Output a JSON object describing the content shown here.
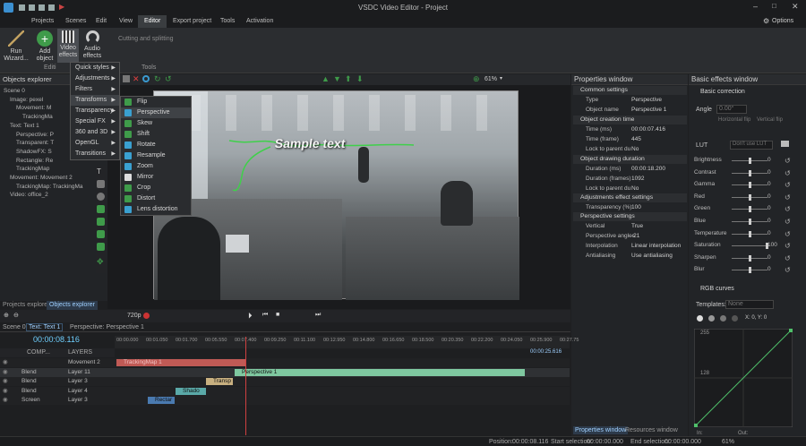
{
  "app": {
    "title": "VSDC Video Editor - Project",
    "options_label": "Options"
  },
  "menu_tabs": [
    "Projects",
    "Scenes",
    "Edit",
    "View",
    "Editor",
    "Export project",
    "Tools",
    "Activation"
  ],
  "ribbon": {
    "run_wizard": "Run Wizard...",
    "add_object": "Add object",
    "video_effects": "Video effects",
    "audio_effects": "Audio effects",
    "cutting": "Cutting and splitting",
    "tools_label": "Tools",
    "editing_label": "Editi"
  },
  "effects_menu": {
    "items": [
      "Quick styles",
      "Adjustments",
      "Filters",
      "Transforms",
      "Transparency",
      "Special FX",
      "360 and 3D",
      "OpenGL",
      "Transitions"
    ],
    "selected": "Transforms"
  },
  "transforms_menu": {
    "items": [
      "Flip",
      "Perspective",
      "Skew",
      "Shift",
      "Rotate",
      "Resample",
      "Zoom",
      "Mirror",
      "Crop",
      "Distort",
      "Lens distortion"
    ],
    "selected": "Perspective"
  },
  "objects_explorer": {
    "title": "Objects explorer",
    "items": [
      {
        "label": "Scene 0",
        "indent": 0
      },
      {
        "label": "Image: pexel",
        "indent": 1
      },
      {
        "label": "Movement: M",
        "indent": 2
      },
      {
        "label": "TrackingMa",
        "indent": 3
      },
      {
        "label": "Text: Text 1",
        "indent": 1
      },
      {
        "label": "Perspective: P",
        "indent": 2
      },
      {
        "label": "Transparent: T",
        "indent": 2
      },
      {
        "label": "ShadowFX: S",
        "indent": 2
      },
      {
        "label": "Rectangle: Re",
        "indent": 2
      },
      {
        "label": "TrackingMap",
        "indent": 2
      },
      {
        "label": "Movement: Movement 2",
        "indent": 1
      },
      {
        "label": "TrackingMap: TrackingMa",
        "indent": 2
      },
      {
        "label": "Video: office_2",
        "indent": 1
      }
    ],
    "tabs": [
      "Projects explorer",
      "Objects explorer"
    ]
  },
  "preview": {
    "sample_text": "Sample text",
    "zoom": "61%",
    "quality": "720p"
  },
  "properties": {
    "title": "Properties window",
    "common": "Common settings",
    "type_label": "Type",
    "type_value": "Perspective",
    "object_name_label": "Object name",
    "object_name_value": "Perspective 1",
    "creation_time": "Object creation time",
    "time_ms_label": "Time (ms)",
    "time_ms_value": "00:00:07.416",
    "time_frame_label": "Time (frame)",
    "time_frame_value": "445",
    "lock_parent_label": "Lock to parent du",
    "lock_parent_value": "No",
    "drawing_duration": "Object drawing duration",
    "duration_ms_label": "Duration (ms)",
    "duration_ms_value": "00:00:18.200",
    "duration_frames_label": "Duration (frames)",
    "duration_frames_value": "1092",
    "lock_parent2_value": "No",
    "adjustments": "Adjustments effect settings",
    "transparency_label": "Transparency (%)",
    "transparency_value": "100",
    "perspective_settings": "Perspective settings",
    "vertical_label": "Vertical",
    "vertical_value": "True",
    "angles_label": "Perspective angles",
    "angles_value": "-21",
    "interp_label": "Interpolation",
    "interp_value": "Linear interpolation",
    "antialias_label": "Antialiasing",
    "antialias_value": "Use antialiasing",
    "tabs": [
      "Properties window",
      "Resources window"
    ]
  },
  "basic_effects": {
    "title": "Basic effects window",
    "basic_correction": "Basic correction",
    "angle_label": "Angle",
    "angle_value": "0.00°",
    "hflip": "Horizontal flip",
    "vflip": "Vertical flip",
    "lut_label": "LUT",
    "lut_value": "Don't use LUT",
    "sliders": [
      {
        "label": "Brightness",
        "value": "0"
      },
      {
        "label": "Contrast",
        "value": "0"
      },
      {
        "label": "Gamma",
        "value": "0"
      },
      {
        "label": "Red",
        "value": "0"
      },
      {
        "label": "Green",
        "value": "0"
      },
      {
        "label": "Blue",
        "value": "0"
      },
      {
        "label": "Temperature",
        "value": "0"
      },
      {
        "label": "Saturation",
        "value": "100"
      },
      {
        "label": "Sharpen",
        "value": "0"
      },
      {
        "label": "Blur",
        "value": "0"
      }
    ],
    "rgb_curves": "RGB curves",
    "templates_label": "Templates:",
    "templates_value": "None",
    "xy_readout": "X: 0, Y: 0",
    "curve_top": "255",
    "curve_mid": "128",
    "in_label": "In:",
    "out_label": "Out:"
  },
  "timeline": {
    "tabs": [
      "Scene 0",
      "Text: Text 1",
      "Perspective: Perspective 1"
    ],
    "time": "00:00:08.116",
    "comp_label": "COMP...",
    "layers_label": "LAYERS",
    "ruler_ticks": [
      "00:00.000",
      "00:01.050",
      "00:01.700",
      "00:05.550",
      "00:07.400",
      "00:09.250",
      "00:11.100",
      "00:12.950",
      "00:14.800",
      "00:16.650",
      "00:18.500",
      "00:20.350",
      "00:22.200",
      "00:24.050",
      "00:25.900",
      "00:27.75"
    ],
    "rows": [
      {
        "blend": "",
        "layer": "Movement 2",
        "clip": "TrackingMap 1"
      },
      {
        "blend": "Blend",
        "layer": "Layer 11",
        "clip": "Perspective 1"
      },
      {
        "blend": "Blend",
        "layer": "Layer 3",
        "clip": "Transp"
      },
      {
        "blend": "Blend",
        "layer": "Layer 4",
        "clip": "Shado"
      },
      {
        "blend": "Screen",
        "layer": "Layer 3",
        "clip": "Rectar"
      }
    ],
    "end_marker": "00:00:25.616"
  },
  "status": {
    "position_label": "Position:",
    "position_value": "00:00:08.116",
    "start_sel_label": "Start selection:",
    "start_sel_value": "00:00:00.000",
    "end_sel_label": "End selection:",
    "end_sel_value": "00:00:00.000",
    "zoom": "61%"
  },
  "colors": {
    "accent_green": "#4caf50",
    "clip_green": "#7fc8a0",
    "clip_teal": "#5aa9a8",
    "clip_red": "#c0504d",
    "highlight": "#3f4246"
  }
}
